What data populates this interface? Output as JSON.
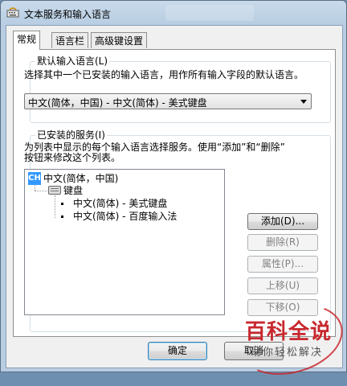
{
  "window": {
    "title": "文本服务和输入语言"
  },
  "tabs": [
    {
      "label": "常规",
      "active": true
    },
    {
      "label": "语言栏",
      "active": false
    },
    {
      "label": "高级键设置",
      "active": false
    }
  ],
  "default_language": {
    "group_label": "默认输入语言(L)",
    "description": "选择其中一个已安装的输入语言，用作所有输入字段的默认语言。",
    "selected": "中文(简体，中国) - 中文(简体) - 美式键盘"
  },
  "installed_services": {
    "group_label": "已安装的服务(I)",
    "description_line1": "为列表中显示的每个输入语言选择服务。使用“添加”和“删除”",
    "description_line2": "按钮来修改这个列表。",
    "tree": {
      "root_badge": "CH",
      "root_label": "中文(简体，中国)",
      "category_label": "键盘",
      "items": [
        "中文(简体) - 美式键盘",
        "中文(简体) - 百度输入法"
      ]
    },
    "buttons": {
      "add": "添加(D)...",
      "remove": "删除(R)",
      "properties": "属性(P)...",
      "move_up": "上移(U)",
      "move_down": "下移(O)"
    }
  },
  "footer": {
    "ok": "确定",
    "cancel": "取消"
  },
  "watermark": {
    "title": "百科全说",
    "subtitle": "助你轻松解决"
  },
  "colors": {
    "selection": "#3399ff",
    "watermark_red": "#c7282e",
    "dialog_bg": "#f0f0f0"
  }
}
